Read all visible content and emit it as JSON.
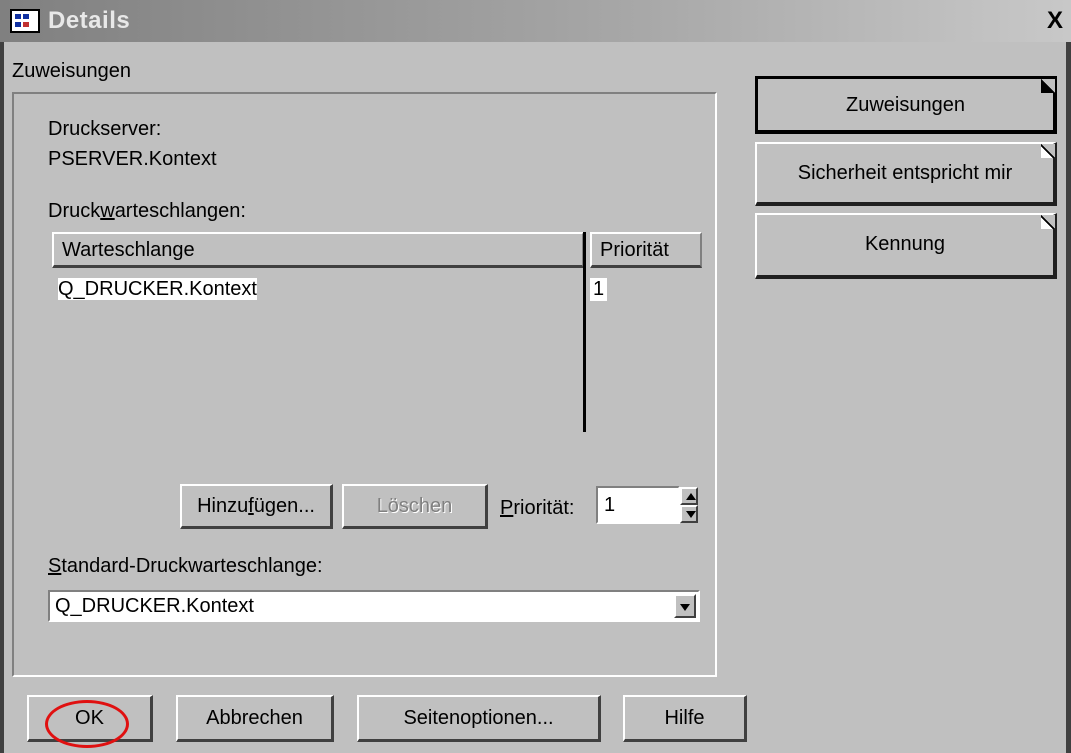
{
  "window": {
    "title": "Details",
    "close_glyph": "X"
  },
  "group": {
    "label": "Zuweisungen"
  },
  "server": {
    "label": "Druckserver:",
    "value": "PSERVER.Kontext"
  },
  "queues": {
    "label_pre": "Druck",
    "label_ul": "w",
    "label_post": "arteschlangen:",
    "columns": [
      "Warteschlange",
      "Priorität"
    ],
    "rows": [
      {
        "queue": "Q_DRUCKER.Kontext",
        "priority": "1"
      }
    ]
  },
  "actions": {
    "add_pre": "Hinzu",
    "add_ul": "f",
    "add_post": "ügen...",
    "delete_label": "Löschen",
    "priority_pre": "",
    "priority_ul": "P",
    "priority_post": "riorität:",
    "priority_value": "1"
  },
  "default_queue": {
    "label_ul": "S",
    "label_post": "tandard-Druckwarteschlange:",
    "value": "Q_DRUCKER.Kontext"
  },
  "pages": [
    {
      "label": "Zuweisungen",
      "active": true
    },
    {
      "label": "Sicherheit entspricht mir",
      "active": false
    },
    {
      "label": "Kennung",
      "active": false
    }
  ],
  "footer": {
    "ok": "OK",
    "cancel": "Abbrechen",
    "page_options": "Seitenoptionen...",
    "help": "Hilfe"
  },
  "icons": {
    "title": "details-window-icon",
    "close": "close-icon",
    "spin_up": "arrow-up-icon",
    "spin_down": "arrow-down-icon",
    "dropdown": "dropdown-arrow-icon"
  },
  "colors": {
    "window_bg": "#c0c0c0",
    "title_gradient_start": "#808080",
    "annotation": "#e01010"
  }
}
